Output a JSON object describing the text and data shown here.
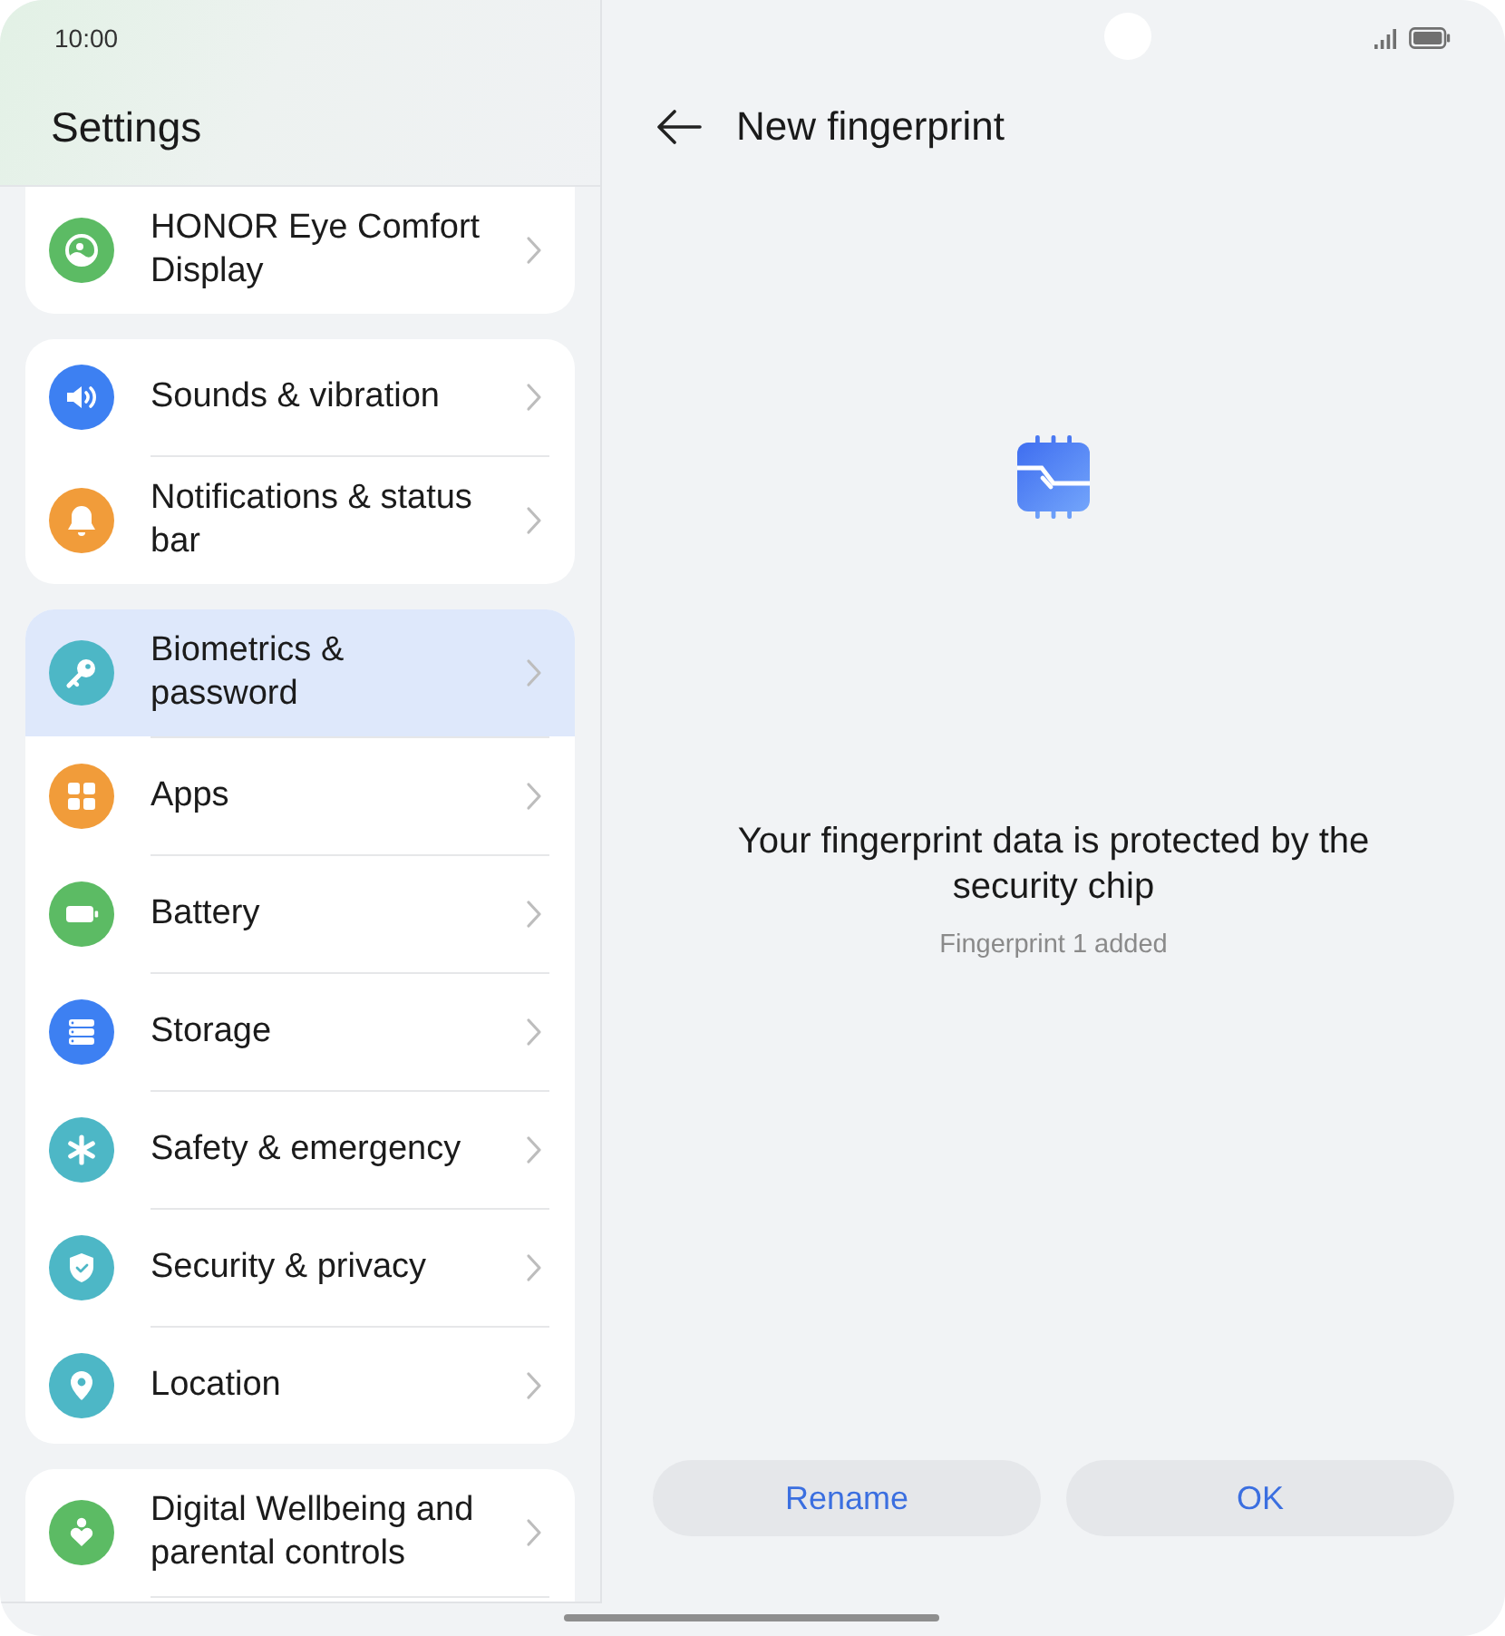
{
  "status_bar": {
    "time": "10:00"
  },
  "sidebar": {
    "title": "Settings",
    "groups": [
      {
        "items": [
          {
            "label": "HONOR Eye Comfort Display",
            "color": "#5cbb64",
            "selected": false
          }
        ]
      },
      {
        "items": [
          {
            "label": "Sounds & vibration",
            "color": "#3d80f2",
            "selected": false
          },
          {
            "label": "Notifications & status bar",
            "color": "#f19c3a",
            "selected": false
          }
        ]
      },
      {
        "items": [
          {
            "label": "Biometrics & password",
            "color": "#4db7c6",
            "selected": true
          },
          {
            "label": "Apps",
            "color": "#f19c3a",
            "selected": false
          },
          {
            "label": "Battery",
            "color": "#5cbb64",
            "selected": false
          },
          {
            "label": "Storage",
            "color": "#3d80f2",
            "selected": false
          },
          {
            "label": "Safety & emergency",
            "color": "#4db7c6",
            "selected": false
          },
          {
            "label": "Security & privacy",
            "color": "#4db7c6",
            "selected": false
          },
          {
            "label": "Location",
            "color": "#4db7c6",
            "selected": false
          }
        ]
      },
      {
        "continues": true,
        "items": [
          {
            "label": "Digital Wellbeing and parental controls",
            "color": "#5cbb64",
            "selected": false
          }
        ]
      }
    ]
  },
  "detail": {
    "title": "New fingerprint",
    "message": "Your fingerprint data is protected by the security chip",
    "caption": "Fingerprint 1 added",
    "buttons": [
      {
        "label": "Rename"
      },
      {
        "label": "OK"
      }
    ]
  }
}
